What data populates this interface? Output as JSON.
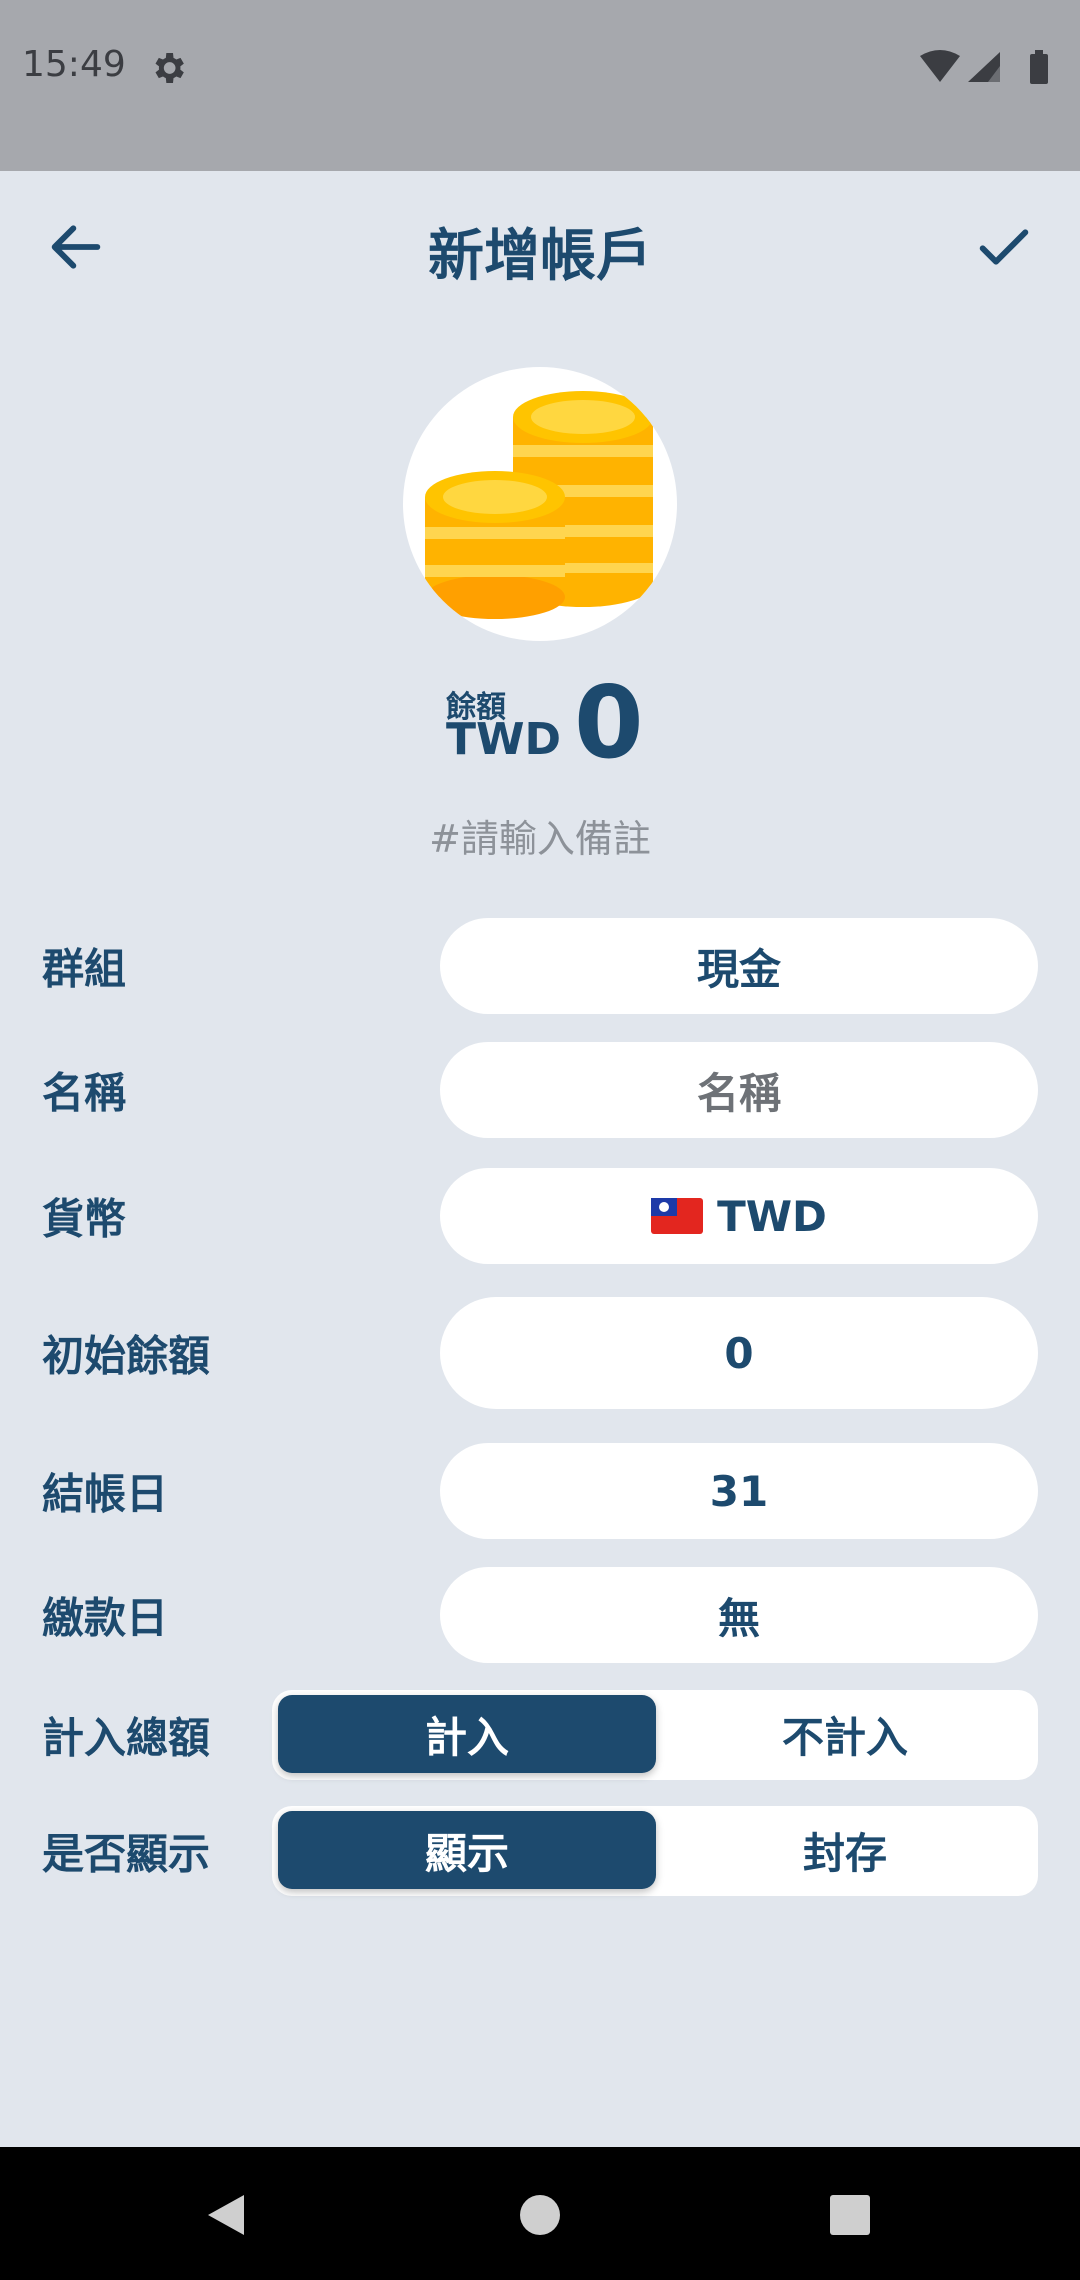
{
  "status_bar": {
    "time": "15:49",
    "icons": [
      "gear-icon",
      "wifi-icon",
      "signal-icon",
      "battery-icon"
    ]
  },
  "header": {
    "title": "新增帳戶",
    "back_icon": "arrow-left-icon",
    "confirm_icon": "check-icon"
  },
  "account": {
    "avatar_icon": "coins-icon",
    "balance_label": "餘額",
    "currency": "TWD",
    "amount": "0",
    "note_placeholder": "#請輸入備註"
  },
  "form": {
    "group": {
      "label": "群組",
      "value": "現金"
    },
    "name": {
      "label": "名稱",
      "placeholder": "名稱"
    },
    "currency": {
      "label": "貨幣",
      "value": "TWD",
      "flag_icon": "taiwan-flag-icon"
    },
    "initial_balance": {
      "label": "初始餘額",
      "value": "0"
    },
    "statement_day": {
      "label": "結帳日",
      "value": "31"
    },
    "payment_day": {
      "label": "繳款日",
      "value": "無"
    },
    "include_total": {
      "label": "計入總額",
      "options": [
        "計入",
        "不計入"
      ],
      "selected": "計入"
    },
    "visibility": {
      "label": "是否顯示",
      "options": [
        "顯示",
        "封存"
      ],
      "selected": "顯示"
    }
  },
  "colors": {
    "primary": "#1d4a6e",
    "background": "#e1e6ed",
    "field": "#ffffff",
    "status_bar": "#a6a8ad",
    "coin": "#ffc400"
  },
  "nav": {
    "back_icon": "triangle-back-icon",
    "home_icon": "circle-home-icon",
    "recents_icon": "square-recents-icon"
  }
}
